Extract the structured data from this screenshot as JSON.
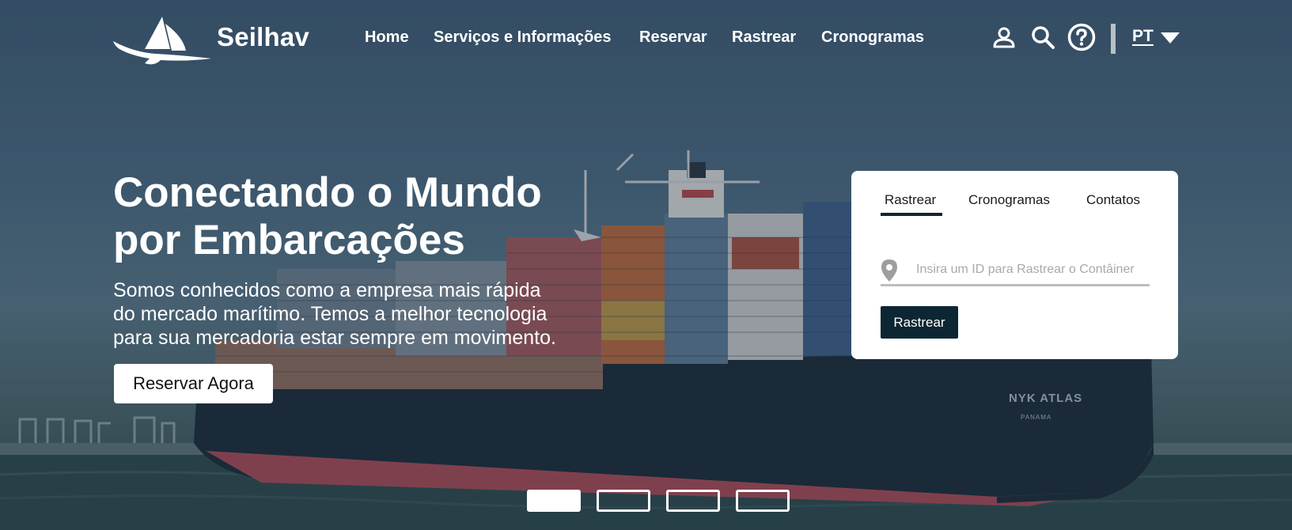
{
  "brand": {
    "name": "Seilhav"
  },
  "nav": {
    "items": [
      {
        "label": "Home"
      },
      {
        "label": "Serviços e Informações"
      },
      {
        "label": "Reservar"
      },
      {
        "label": "Rastrear"
      },
      {
        "label": "Cronogramas"
      }
    ],
    "icons": [
      "user-icon",
      "search-icon",
      "help-icon"
    ],
    "language": "PT"
  },
  "hero": {
    "headline_line1": "Conectando o Mundo",
    "headline_line2": "por Embarcações",
    "sub_line1": "Somos conhecidos como a empresa mais rápida",
    "sub_line2": "do mercado marítimo. Temos a melhor tecnologia",
    "sub_line3": "para sua mercadoria estar sempre em movimento.",
    "cta_label": "Reservar Agora",
    "ship_name": "NYK ATLAS",
    "ship_port": "PANAMA"
  },
  "widget": {
    "tabs": [
      {
        "label": "Rastrear",
        "active": true
      },
      {
        "label": "Cronogramas",
        "active": false
      },
      {
        "label": "Contatos",
        "active": false
      }
    ],
    "input_placeholder": "Insira um ID para Rastrear o Contâiner",
    "input_value": "",
    "button_label": "Rastrear"
  },
  "carousel": {
    "count": 4,
    "active_index": 0
  },
  "colors": {
    "accent_dark": "#0c2733",
    "white": "#ffffff",
    "input_border": "#bdbdbd"
  }
}
